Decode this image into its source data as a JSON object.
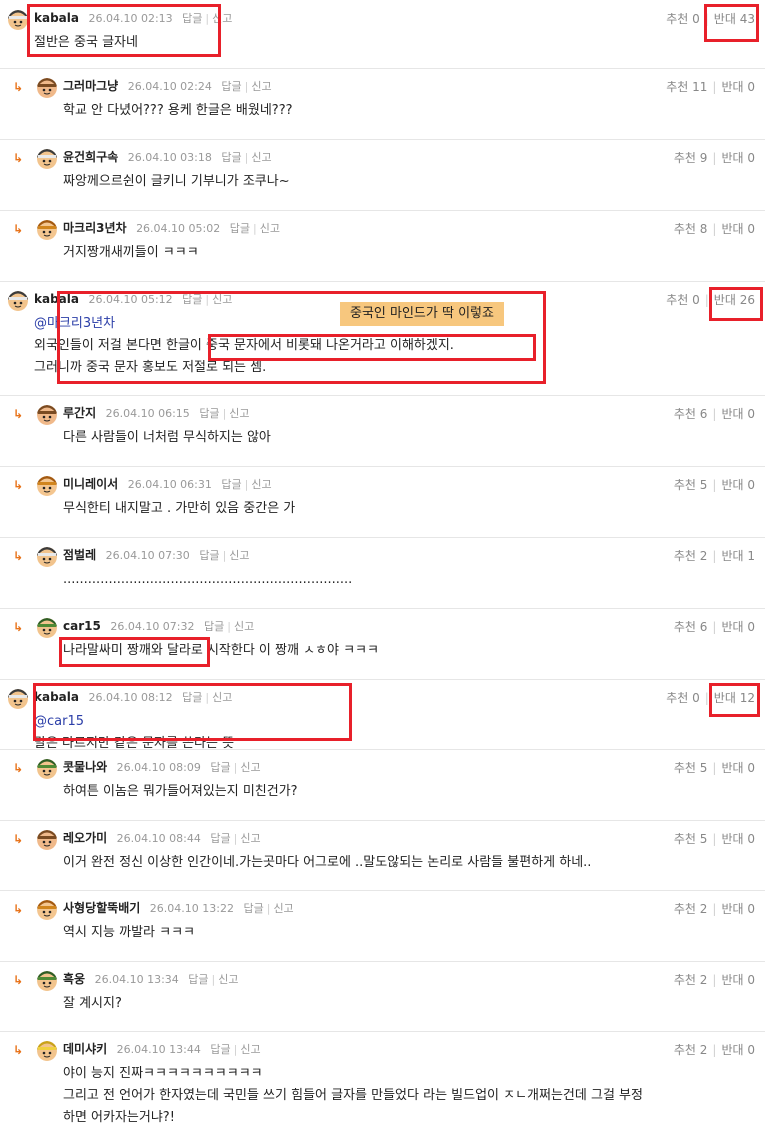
{
  "labels": {
    "reply": "답글",
    "report": "신고",
    "up": "추천",
    "down": "반대",
    "reply_arrow": "↳"
  },
  "annotation": "중국인 마인드가 딱 이렇죠",
  "comments": [
    {
      "nick": "kabala",
      "date": "26.04.10 02:13",
      "up": "0",
      "down": "43",
      "lines": [
        "절반은 중국 글자네"
      ],
      "avatar": "helmet"
    },
    {
      "nick": "그러마그냥",
      "date": "26.04.10 02:24",
      "up": "11",
      "down": "0",
      "lines": [
        "학교 안 다녔어??? 용케 한글은 배웠네???"
      ],
      "avatar": "brown"
    },
    {
      "nick": "윤건희구속",
      "date": "26.04.10 03:18",
      "up": "9",
      "down": "0",
      "lines": [
        "짜앙께으르쉰이 글키니 기부니가 조쿠나~"
      ],
      "avatar": "helmet"
    },
    {
      "nick": "마크리3년차",
      "date": "26.04.10 05:02",
      "up": "8",
      "down": "0",
      "lines": [
        "거지짱개새끼들이 ㅋㅋㅋ"
      ],
      "avatar": "orange"
    },
    {
      "nick": "kabala",
      "date": "26.04.10 05:12",
      "up": "0",
      "down": "26",
      "mention": "@마크리3년차",
      "lines": [
        "외국인들이 저걸 본다면 한글이 중국 문자에서 비롯돼 나온거라고 이해하겠지.",
        "그러니까 중국 문자 홍보도 저절로 되는 셈."
      ],
      "avatar": "helmet"
    },
    {
      "nick": "루간지",
      "date": "26.04.10 06:15",
      "up": "6",
      "down": "0",
      "lines": [
        "다른 사람들이 너처럼 무식하지는 않아"
      ],
      "avatar": "brown"
    },
    {
      "nick": "미니레이서",
      "date": "26.04.10 06:31",
      "up": "5",
      "down": "0",
      "lines": [
        "무식한티 내지말고 . 가만히 있음 중간은 가"
      ],
      "avatar": "orange"
    },
    {
      "nick": "점벌레",
      "date": "26.04.10 07:30",
      "up": "2",
      "down": "1",
      "lines": [
        "......................................................................"
      ],
      "avatar": "helmet"
    },
    {
      "nick": "car15",
      "date": "26.04.10 07:32",
      "up": "6",
      "down": "0",
      "lines": [
        "나라말싸미 짱깨와 달라로 시작한다 이 짱깨 ㅅㅎ야 ㅋㅋㅋ"
      ],
      "avatar": "green"
    },
    {
      "nick": "kabala",
      "date": "26.04.10 08:12",
      "up": "0",
      "down": "12",
      "mention": "@car15",
      "lines": [
        "말은 다르지만 같은 문자를 쓴다는 뜻"
      ],
      "avatar": "helmet"
    },
    {
      "nick": "콧물나와",
      "date": "26.04.10 08:09",
      "up": "5",
      "down": "0",
      "lines": [
        "하여튼 이놈은 뭐가들어져있는지 미친건가?"
      ],
      "avatar": "green"
    },
    {
      "nick": "레오가미",
      "date": "26.04.10 08:44",
      "up": "5",
      "down": "0",
      "lines": [
        "이거 완전 정신 이상한 인간이네.가는곳마다 어그로에 ..말도않되는 논리로 사람들 불편하게 하네.."
      ],
      "avatar": "brown"
    },
    {
      "nick": "사형당할뚝배기",
      "date": "26.04.10 13:22",
      "up": "2",
      "down": "0",
      "lines": [
        "역시 지능 까발라 ㅋㅋㅋ"
      ],
      "avatar": "orange"
    },
    {
      "nick": "흑웅",
      "date": "26.04.10 13:34",
      "up": "2",
      "down": "0",
      "lines": [
        "잘 계시지?"
      ],
      "avatar": "green"
    },
    {
      "nick": "데미샤키",
      "date": "26.04.10 13:44",
      "up": "2",
      "down": "0",
      "lines": [
        "야이 능지 진짜ㅋㅋㅋㅋㅋㅋㅋㅋㅋㅋ",
        "그리고 전 언어가 한자였는데 국민들 쓰기 힘들어 글자를 만들었다 라는 빌드업이 ㅈㄴ개쩌는건데 그걸 부정",
        "하면 어카자는거냐?!"
      ],
      "avatar": "yellow"
    }
  ]
}
